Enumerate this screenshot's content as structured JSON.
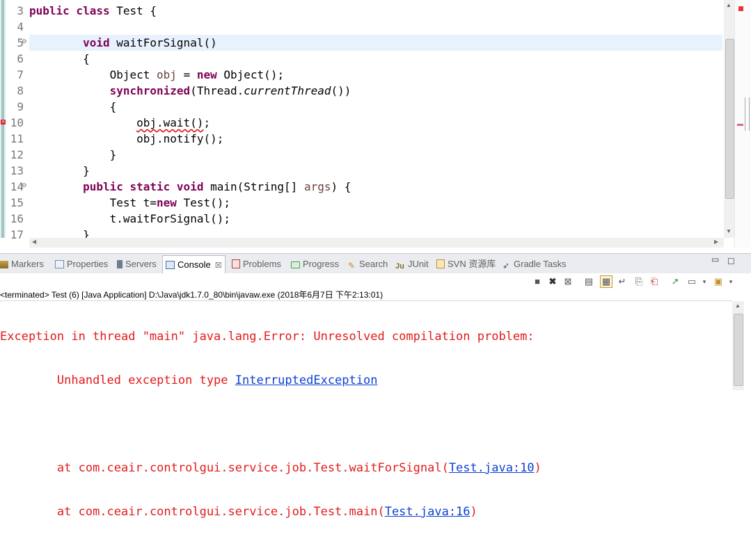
{
  "editor": {
    "line_numbers": [
      "3",
      "4",
      "5",
      "6",
      "7",
      "8",
      "9",
      "10",
      "11",
      "12",
      "13",
      "14",
      "15",
      "16",
      "17"
    ],
    "lines": [
      {
        "parts": [
          [
            "kw",
            "public class"
          ],
          [
            "n",
            " Test {"
          ]
        ]
      },
      {
        "parts": []
      },
      {
        "parts": [
          [
            "n",
            "        "
          ],
          [
            "kw",
            "void"
          ],
          [
            "n",
            " waitForSignal()"
          ]
        ]
      },
      {
        "parts": [
          [
            "n",
            "        {"
          ]
        ]
      },
      {
        "parts": [
          [
            "n",
            "            Object "
          ],
          [
            "p",
            "obj"
          ],
          [
            "n",
            " = "
          ],
          [
            "kw",
            "new"
          ],
          [
            "n",
            " Object();"
          ]
        ]
      },
      {
        "parts": [
          [
            "n",
            "            "
          ],
          [
            "kw",
            "synchronized"
          ],
          [
            "n",
            "(Thread."
          ],
          [
            "it",
            "currentThread"
          ],
          [
            "n",
            "())"
          ]
        ]
      },
      {
        "parts": [
          [
            "n",
            "            {"
          ]
        ]
      },
      {
        "parts": [
          [
            "n",
            "                "
          ],
          [
            "err",
            "obj.wait()"
          ],
          [
            "n",
            ";"
          ]
        ]
      },
      {
        "parts": [
          [
            "n",
            "                obj.notify();"
          ]
        ]
      },
      {
        "parts": [
          [
            "n",
            "            }"
          ]
        ]
      },
      {
        "parts": [
          [
            "n",
            "        }"
          ]
        ]
      },
      {
        "parts": [
          [
            "n",
            "        "
          ],
          [
            "kw",
            "public static void"
          ],
          [
            "n",
            " main(String[] "
          ],
          [
            "p",
            "args"
          ],
          [
            "n",
            ") {"
          ]
        ]
      },
      {
        "parts": [
          [
            "n",
            "            Test t="
          ],
          [
            "kw",
            "new"
          ],
          [
            "n",
            " Test();"
          ]
        ]
      },
      {
        "parts": [
          [
            "n",
            "            t.waitForSignal();"
          ]
        ]
      },
      {
        "parts": [
          [
            "n",
            "        }"
          ]
        ]
      }
    ]
  },
  "views": {
    "tabs": [
      {
        "label": "Markers",
        "icon": "markers-icon"
      },
      {
        "label": "Properties",
        "icon": "properties-icon"
      },
      {
        "label": "Servers",
        "icon": "servers-icon"
      },
      {
        "label": "Console",
        "icon": "console-icon",
        "active": true
      },
      {
        "label": "Problems",
        "icon": "problems-icon"
      },
      {
        "label": "Progress",
        "icon": "progress-icon"
      },
      {
        "label": "Search",
        "icon": "search-icon"
      },
      {
        "label": "JUnit",
        "icon": "junit-icon"
      },
      {
        "label": "SVN 资源库",
        "icon": "svn-icon"
      },
      {
        "label": "Gradle Tasks",
        "icon": "gradle-icon"
      }
    ]
  },
  "console": {
    "terminated": "<terminated> Test (6) [Java Application] D:\\Java\\jdk1.7.0_80\\bin\\javaw.exe (2018年6月7日 下午2:13:01)",
    "line1": "Exception in thread \"main\" java.lang.Error: Unresolved compilation problem: ",
    "line2_prefix": "\tUnhandled exception type ",
    "line2_link": "InterruptedException",
    "line4_prefix": "\tat com.ceair.controlgui.service.job.Test.waitForSignal(",
    "line4_link": "Test.java:10",
    "line4_suffix": ")",
    "line5_prefix": "\tat com.ceair.controlgui.service.job.Test.main(",
    "line5_link": "Test.java:16",
    "line5_suffix": ")"
  }
}
